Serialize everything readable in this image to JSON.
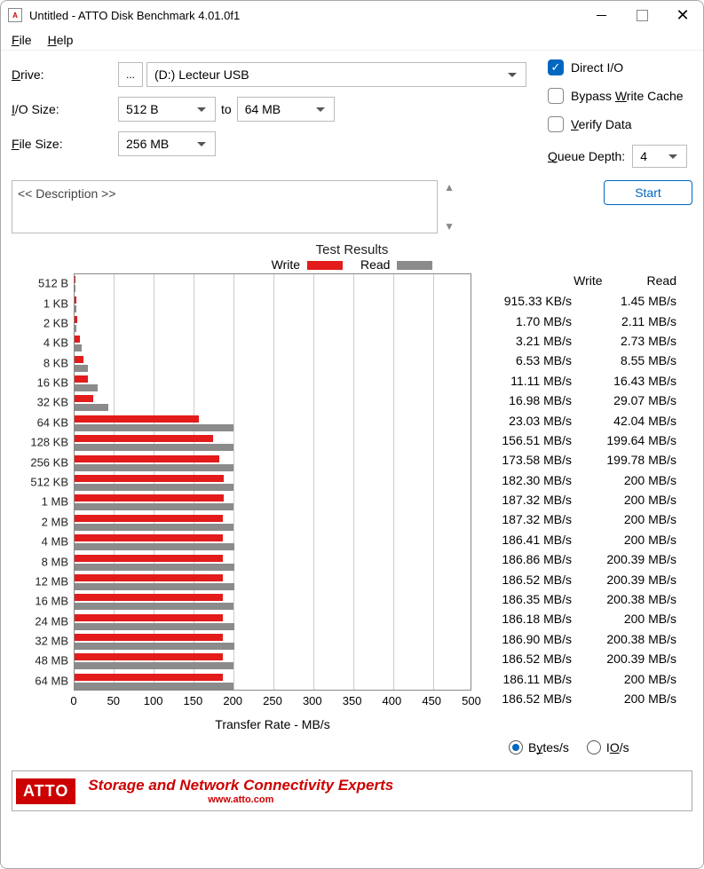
{
  "window": {
    "title": "Untitled - ATTO Disk Benchmark 4.01.0f1"
  },
  "menu": {
    "file": "File",
    "help": "Help"
  },
  "form": {
    "drive_label": "Drive:",
    "drive_value": "(D:) Lecteur USB",
    "iosize_label": "I/O Size:",
    "iosize_from": "512 B",
    "iosize_to_label": "to",
    "iosize_to": "64 MB",
    "filesize_label": "File Size:",
    "filesize_value": "256 MB"
  },
  "options": {
    "direct_io": "Direct I/O",
    "bypass": "Bypass Write Cache",
    "verify": "Verify Data",
    "queue_depth_label": "Queue Depth:",
    "queue_depth_value": "4"
  },
  "description_placeholder": "<< Description >>",
  "buttons": {
    "start": "Start"
  },
  "results": {
    "title": "Test Results",
    "legend_write": "Write",
    "legend_read": "Read",
    "xlabel": "Transfer Rate - MB/s",
    "col_write": "Write",
    "col_read": "Read"
  },
  "radio": {
    "bytes": "Bytes/s",
    "ios": "IO/s"
  },
  "banner": {
    "brand": "ATTO",
    "tagline": "Storage and Network Connectivity Experts",
    "url": "www.atto.com"
  },
  "chart_data": {
    "type": "bar",
    "title": "Test Results",
    "xlabel": "Transfer Rate - MB/s",
    "ylabel": "",
    "xlim": [
      0,
      500
    ],
    "xticks": [
      0,
      50,
      100,
      150,
      200,
      250,
      300,
      350,
      400,
      450,
      500
    ],
    "categories": [
      "512 B",
      "1 KB",
      "2 KB",
      "4 KB",
      "8 KB",
      "16 KB",
      "32 KB",
      "64 KB",
      "128 KB",
      "256 KB",
      "512 KB",
      "1 MB",
      "2 MB",
      "4 MB",
      "8 MB",
      "12 MB",
      "16 MB",
      "24 MB",
      "32 MB",
      "48 MB",
      "64 MB"
    ],
    "series": [
      {
        "name": "Write",
        "color": "#e31b1b",
        "values_mb_s": [
          0.915,
          1.7,
          3.21,
          6.53,
          11.11,
          16.98,
          23.03,
          156.51,
          173.58,
          182.3,
          187.32,
          187.32,
          186.41,
          186.86,
          186.52,
          186.35,
          186.18,
          186.9,
          186.52,
          186.11,
          186.52
        ],
        "display": [
          "915.33 KB/s",
          "1.70 MB/s",
          "3.21 MB/s",
          "6.53 MB/s",
          "11.11 MB/s",
          "16.98 MB/s",
          "23.03 MB/s",
          "156.51 MB/s",
          "173.58 MB/s",
          "182.30 MB/s",
          "187.32 MB/s",
          "187.32 MB/s",
          "186.41 MB/s",
          "186.86 MB/s",
          "186.52 MB/s",
          "186.35 MB/s",
          "186.18 MB/s",
          "186.90 MB/s",
          "186.52 MB/s",
          "186.11 MB/s",
          "186.52 MB/s"
        ]
      },
      {
        "name": "Read",
        "color": "#8b8b8b",
        "values_mb_s": [
          1.45,
          2.11,
          2.73,
          8.55,
          16.43,
          29.07,
          42.04,
          199.64,
          199.78,
          200,
          200,
          200,
          200,
          200.39,
          200.39,
          200.38,
          200,
          200.38,
          200.39,
          200,
          200
        ],
        "display": [
          "1.45 MB/s",
          "2.11 MB/s",
          "2.73 MB/s",
          "8.55 MB/s",
          "16.43 MB/s",
          "29.07 MB/s",
          "42.04 MB/s",
          "199.64 MB/s",
          "199.78 MB/s",
          "200 MB/s",
          "200 MB/s",
          "200 MB/s",
          "200 MB/s",
          "200.39 MB/s",
          "200.39 MB/s",
          "200.38 MB/s",
          "200 MB/s",
          "200.38 MB/s",
          "200.39 MB/s",
          "200 MB/s",
          "200 MB/s"
        ]
      }
    ]
  }
}
